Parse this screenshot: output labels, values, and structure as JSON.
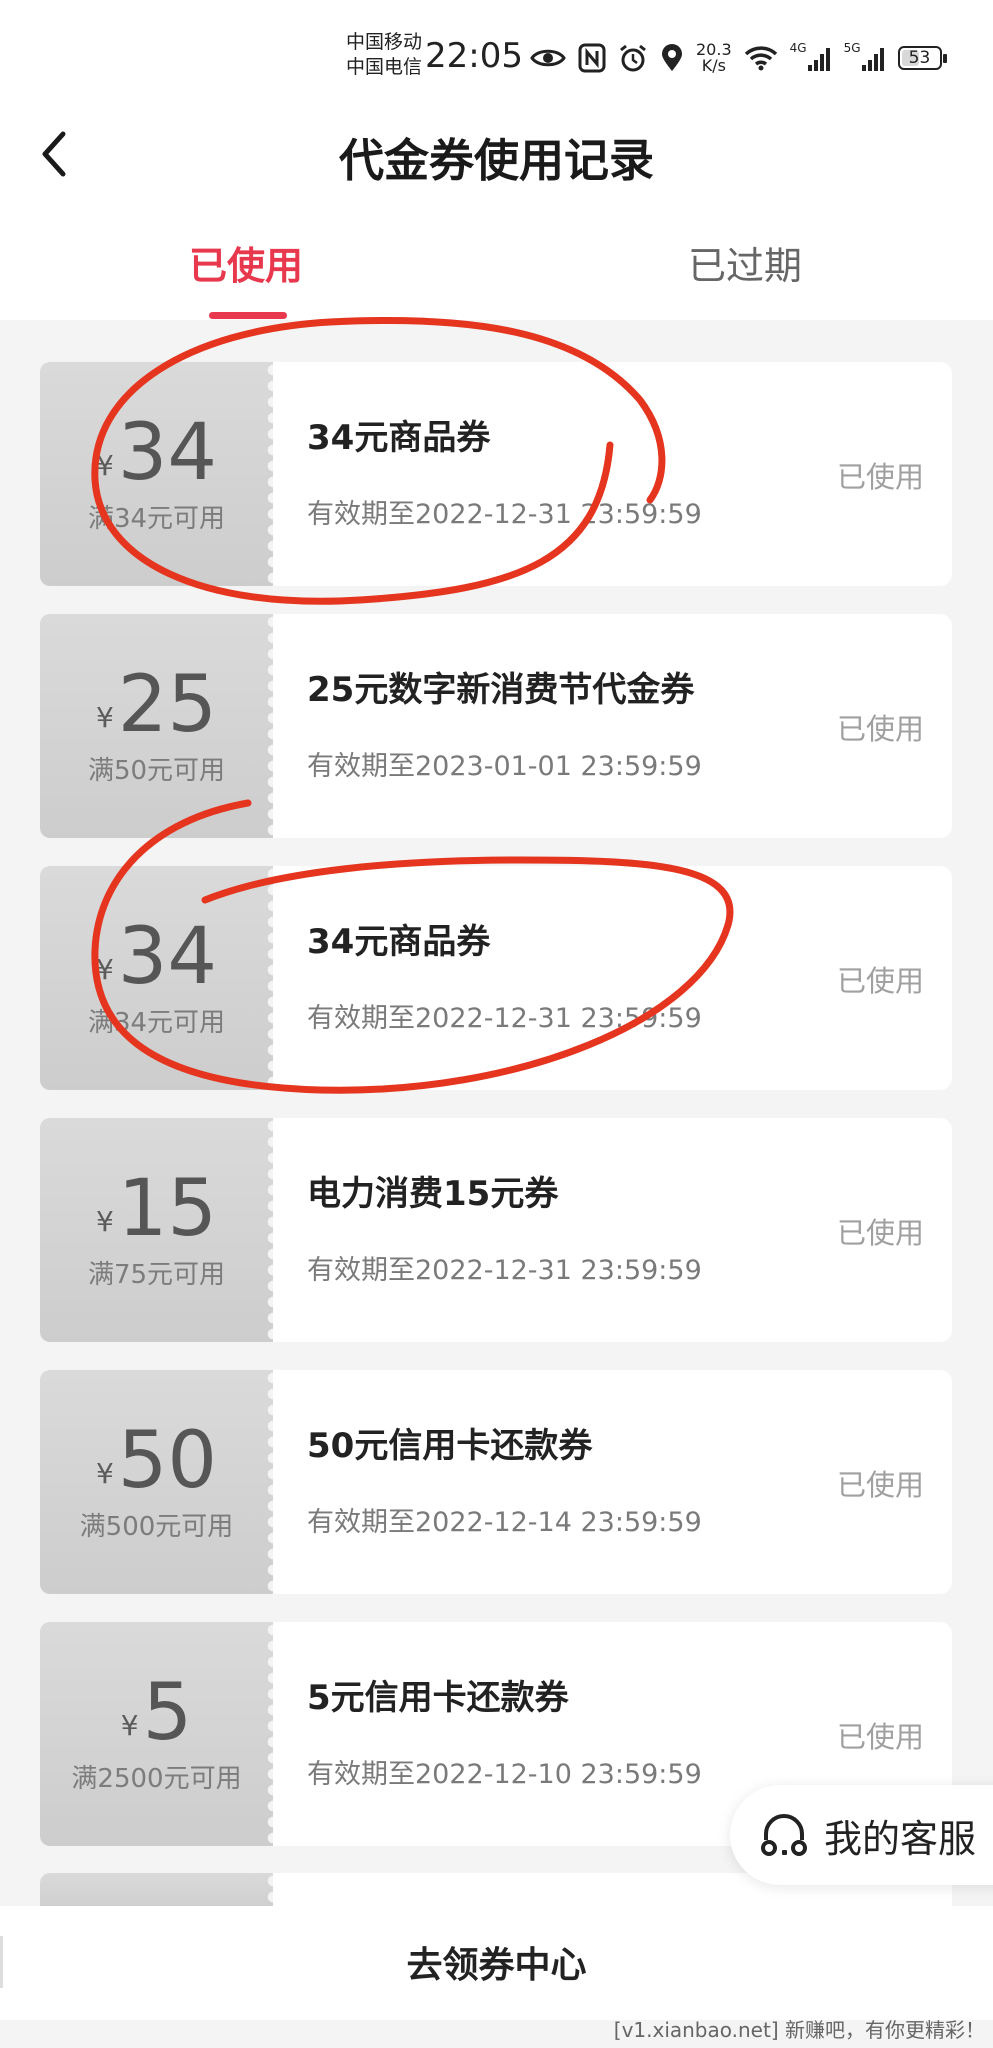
{
  "status_bar": {
    "carrier_1": "中国移动",
    "carrier_2": "中国电信",
    "time": "22:05",
    "net_speed_value": "20.3",
    "net_speed_unit": "K/s",
    "signal_1_label": "4G",
    "signal_2_label": "5G",
    "battery": "53",
    "battery_level": 0.53,
    "icons": [
      "eye-icon",
      "nfc-icon",
      "alarm-icon",
      "location-icon",
      "wifi-icon",
      "signal-icon",
      "battery-icon"
    ]
  },
  "header": {
    "title": "代金券使用记录",
    "back_icon": "chevron-left-icon"
  },
  "tabs": [
    {
      "label": "已使用",
      "active": true
    },
    {
      "label": "已过期",
      "active": false
    }
  ],
  "colors": {
    "accent": "#e8384d",
    "annotation": "#e5351f",
    "page_bg": "#f4f4f4"
  },
  "coupons": [
    {
      "currency": "¥",
      "amount": "34",
      "condition": "满34元可用",
      "name": "34元商品券",
      "validity": "有效期至2022-12-31 23:59:59",
      "status": "已使用"
    },
    {
      "currency": "¥",
      "amount": "25",
      "condition": "满50元可用",
      "name": "25元数字新消费节代金券",
      "validity": "有效期至2023-01-01 23:59:59",
      "status": "已使用"
    },
    {
      "currency": "¥",
      "amount": "34",
      "condition": "满34元可用",
      "name": "34元商品券",
      "validity": "有效期至2022-12-31 23:59:59",
      "status": "已使用"
    },
    {
      "currency": "¥",
      "amount": "15",
      "condition": "满75元可用",
      "name": "电力消费15元券",
      "validity": "有效期至2022-12-31 23:59:59",
      "status": "已使用"
    },
    {
      "currency": "¥",
      "amount": "50",
      "condition": "满500元可用",
      "name": "50元信用卡还款券",
      "validity": "有效期至2022-12-14 23:59:59",
      "status": "已使用"
    },
    {
      "currency": "¥",
      "amount": "5",
      "condition": "满2500元可用",
      "name": "5元信用卡还款券",
      "validity": "有效期至2022-12-10 23:59:59",
      "status": "已使用"
    }
  ],
  "customer_service": {
    "label": "我的客服",
    "icon": "headset-icon"
  },
  "bottom_bar": {
    "link_label": "去领券中心"
  },
  "watermark": "[v1.xianbao.net] 新赚吧，有你更精彩！"
}
